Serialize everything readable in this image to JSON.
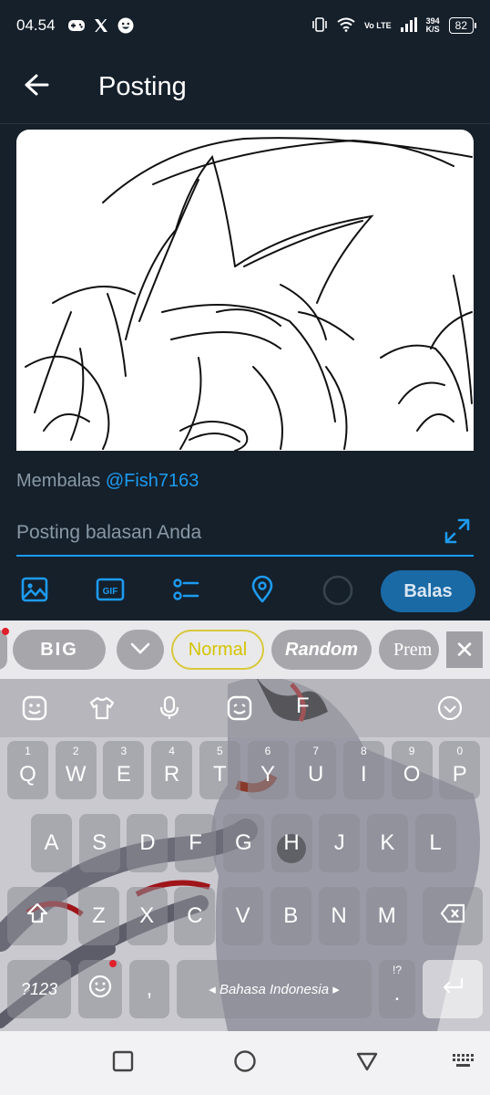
{
  "status": {
    "time": "04.54",
    "network": "Vo LTE",
    "speed_value": "394",
    "speed_unit": "K/S",
    "battery": "82",
    "left_icons": [
      "gamepad-icon",
      "x-logo-icon",
      "smiley-icon"
    ],
    "right_icons": [
      "vibrate-icon",
      "wifi-icon",
      "signal-icon"
    ]
  },
  "header": {
    "title": "Posting",
    "back_icon": "arrow-left-icon"
  },
  "reply": {
    "prefix": "Membalas ",
    "handle": "@Fish7163",
    "placeholder": "Posting balasan Anda",
    "value": ""
  },
  "toolbar": {
    "icons": [
      "image-icon",
      "gif-icon",
      "poll-icon",
      "location-icon",
      "progress-circle-icon"
    ],
    "gif_label": "GIF",
    "reply_label": "Balas"
  },
  "keyboard": {
    "font_chips": [
      "BIG",
      "Normal",
      "Random",
      "Prem"
    ],
    "close_label": "✕",
    "toolbar_icons": [
      "sticker-icon",
      "theme-shirt-icon",
      "microphone-icon",
      "emoji-icon",
      "font-icon",
      "chevron-down-icon"
    ],
    "font_letter": "F",
    "row1": [
      {
        "num": "1",
        "key": "Q"
      },
      {
        "num": "2",
        "key": "W"
      },
      {
        "num": "3",
        "key": "E"
      },
      {
        "num": "4",
        "key": "R"
      },
      {
        "num": "5",
        "key": "T"
      },
      {
        "num": "6",
        "key": "Y"
      },
      {
        "num": "7",
        "key": "U"
      },
      {
        "num": "8",
        "key": "I"
      },
      {
        "num": "9",
        "key": "O"
      },
      {
        "num": "0",
        "key": "P"
      }
    ],
    "row2": [
      "A",
      "S",
      "D",
      "F",
      "G",
      "H",
      "J",
      "K",
      "L"
    ],
    "row3": [
      "Z",
      "X",
      "C",
      "V",
      "B",
      "N",
      "M"
    ],
    "symbols_label": "?123",
    "comma_label": ",",
    "space_label": "◂  Bahasa Indonesia  ▸",
    "punct_top": "!?",
    "punct_label": ".",
    "shift_icon": "shift-icon",
    "backspace_icon": "backspace-icon",
    "enter_icon": "enter-icon"
  },
  "navbar": {
    "icons": [
      "recent-apps-icon",
      "home-icon",
      "back-icon",
      "keyboard-switch-icon"
    ]
  },
  "colors": {
    "background": "#15202b",
    "accent": "#1d9bf0",
    "reply_button": "#1a6aa6"
  }
}
